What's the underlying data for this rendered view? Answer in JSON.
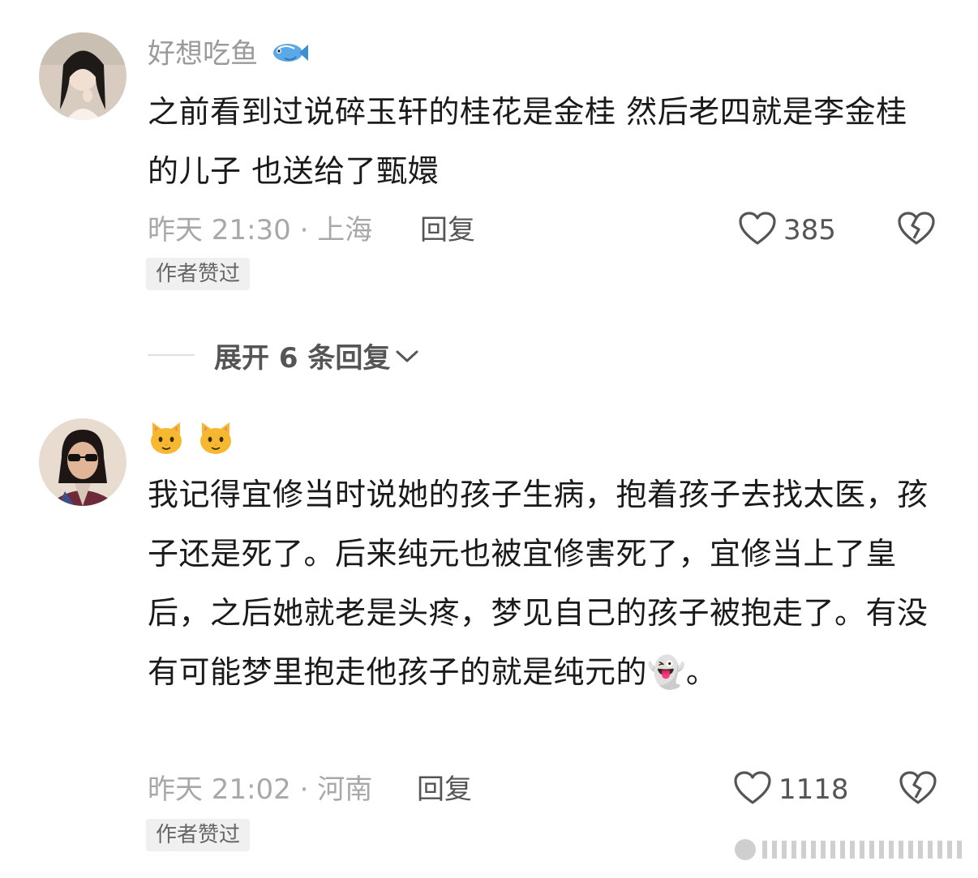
{
  "comments": [
    {
      "username": "好想吃鱼",
      "username_emoji": "fish-icon",
      "body": "之前看到过说碎玉轩的桂花是金桂 然后老四就是李金桂的儿子 也送给了甄嬛",
      "time_location": "昨天 21:30 · 上海",
      "reply_label": "回复",
      "like_count": "385",
      "badge": "作者赞过"
    },
    {
      "username": "🐱🐱",
      "body": "我记得宜修当时说她的孩子生病，抱着孩子去找太医，孩子还是死了。后来纯元也被宜修害死了，宜修当上了皇后，之后她就老是头疼，梦见自己的孩子被抱走了。有没有可能梦里抱走他孩子的就是纯元的👻。",
      "time_location": "昨天 21:02 · 河南",
      "reply_label": "回复",
      "like_count": "1118",
      "badge": "作者赞过"
    }
  ],
  "expand_replies": {
    "label": "展开 6 条回复"
  },
  "colors": {
    "text_primary": "#1a1a1a",
    "text_meta": "#a8a8a8",
    "text_action": "#555555",
    "badge_bg": "#f0f0f0"
  }
}
